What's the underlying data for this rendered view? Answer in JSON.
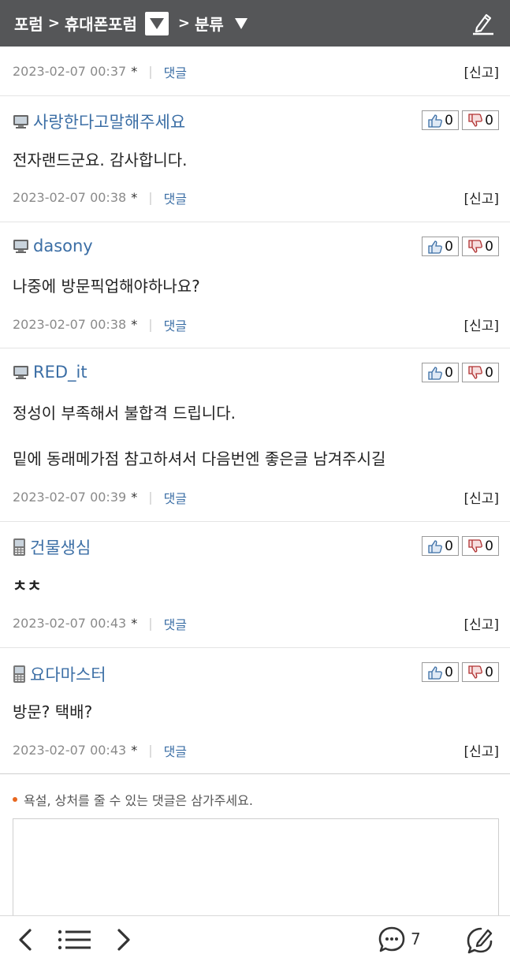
{
  "header": {
    "breadcrumb": [
      "포럼",
      ">",
      "휴대폰포럼",
      ">",
      "분류"
    ]
  },
  "comments": [
    {
      "time": "2023-02-07 00:37",
      "star": "*",
      "reply_label": "댓글",
      "report_label": "[신고]"
    },
    {
      "device": "pc",
      "author": "사랑한다고말해주세요",
      "likes": "0",
      "dislikes": "0",
      "lines": [
        "전자랜드군요. 감사합니다."
      ],
      "time": "2023-02-07 00:38",
      "star": "*",
      "reply_label": "댓글",
      "report_label": "[신고]"
    },
    {
      "device": "pc",
      "author": "dasony",
      "likes": "0",
      "dislikes": "0",
      "lines": [
        "나중에 방문픽업해야하나요?"
      ],
      "time": "2023-02-07 00:38",
      "star": "*",
      "reply_label": "댓글",
      "report_label": "[신고]"
    },
    {
      "device": "pc",
      "author": "RED_it",
      "likes": "0",
      "dislikes": "0",
      "lines": [
        "정성이 부족해서 불합격 드립니다.",
        "밑에 동래메가점 참고하셔서 다음번엔 좋은글 남겨주시길"
      ],
      "time": "2023-02-07 00:39",
      "star": "*",
      "reply_label": "댓글",
      "report_label": "[신고]"
    },
    {
      "device": "mobile",
      "author": "건물생심",
      "likes": "0",
      "dislikes": "0",
      "lines": [
        "ㅊㅊ"
      ],
      "time": "2023-02-07 00:43",
      "star": "*",
      "reply_label": "댓글",
      "report_label": "[신고]"
    },
    {
      "device": "mobile",
      "author": "요다마스터",
      "likes": "0",
      "dislikes": "0",
      "lines": [
        "방문? 택배?"
      ],
      "time": "2023-02-07 00:43",
      "star": "*",
      "reply_label": "댓글",
      "report_label": "[신고]"
    }
  ],
  "comment_form": {
    "notice": "욕설, 상처를 줄 수 있는 댓글은 삼가주세요.",
    "value": ""
  },
  "footer": {
    "comment_count": "7",
    "icons": [
      "prev-icon",
      "list-icon",
      "next-icon",
      "comment-icon",
      "write-icon"
    ]
  },
  "colors": {
    "header_bg": "#555658",
    "link": "#3b6ea5",
    "notice_dot": "#e8671f"
  }
}
